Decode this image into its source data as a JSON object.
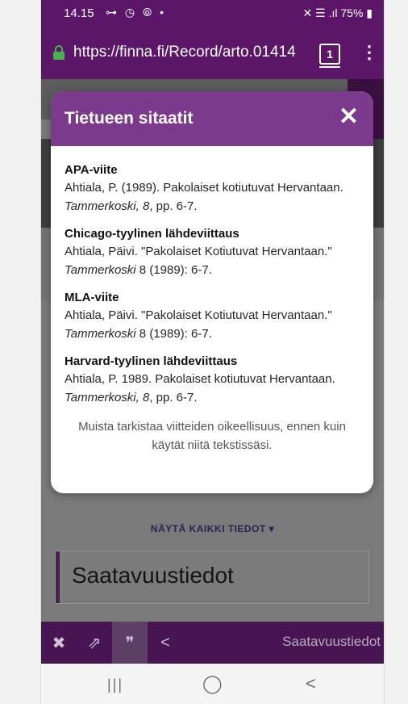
{
  "status": {
    "time": "14.15",
    "left_icons": "⊶ ◷ ⦾ •",
    "right_icons": "✕ ☰ .ıl 75% ▮",
    "battery": "75%"
  },
  "browser": {
    "url": "https://finna.fi/Record/arto.01414",
    "tab_count": "1",
    "menu_icon": "⋮"
  },
  "modal": {
    "title": "Tietueen sitaatit",
    "close_icon": "✕",
    "citations": [
      {
        "label": "APA-viite",
        "text_before": "Ahtiala, P. (1989). Pakolaiset kotiutuvat Hervantaan. ",
        "text_italic": "Tammerkoski, 8",
        "text_after": ", pp. 6-7."
      },
      {
        "label": "Chicago-tyylinen lähdeviittaus",
        "text_before": "Ahtiala, Päivi. \"Pakolaiset Kotiutuvat Hervantaan.\" ",
        "text_italic": "Tammerkoski",
        "text_after": " 8 (1989): 6-7."
      },
      {
        "label": "MLA-viite",
        "text_before": "Ahtiala, Päivi. \"Pakolaiset Kotiutuvat Hervantaan.\" ",
        "text_italic": "Tammerkoski",
        "text_after": " 8 (1989): 6-7."
      },
      {
        "label": "Harvard-tyylinen lähdeviittaus",
        "text_before": "Ahtiala, P. 1989. Pakolaiset kotiutuvat Hervantaan. ",
        "text_italic": "Tammerkoski, 8",
        "text_after": ", pp. 6-7."
      }
    ],
    "note": "Muista tarkistaa viitteiden oikeellisuus, ennen kuin käytät niitä tekstissäsi."
  },
  "page": {
    "show_all": "NÄYTÄ KAIKKI TIEDOT ▾",
    "section_title": "Saatavuustiedot"
  },
  "toolbar": {
    "pin_icon": "✖",
    "export_icon": "⇗",
    "cite_icon": "❞",
    "share_icon": "<",
    "label": "Saatavuustiedot"
  },
  "navbar": {
    "recent_icon": "|||",
    "home_icon": "◯",
    "back_icon": "<"
  },
  "colors": {
    "brand": "#5b1668",
    "modal_header": "#7b3a8c",
    "toolbar": "#461552"
  }
}
